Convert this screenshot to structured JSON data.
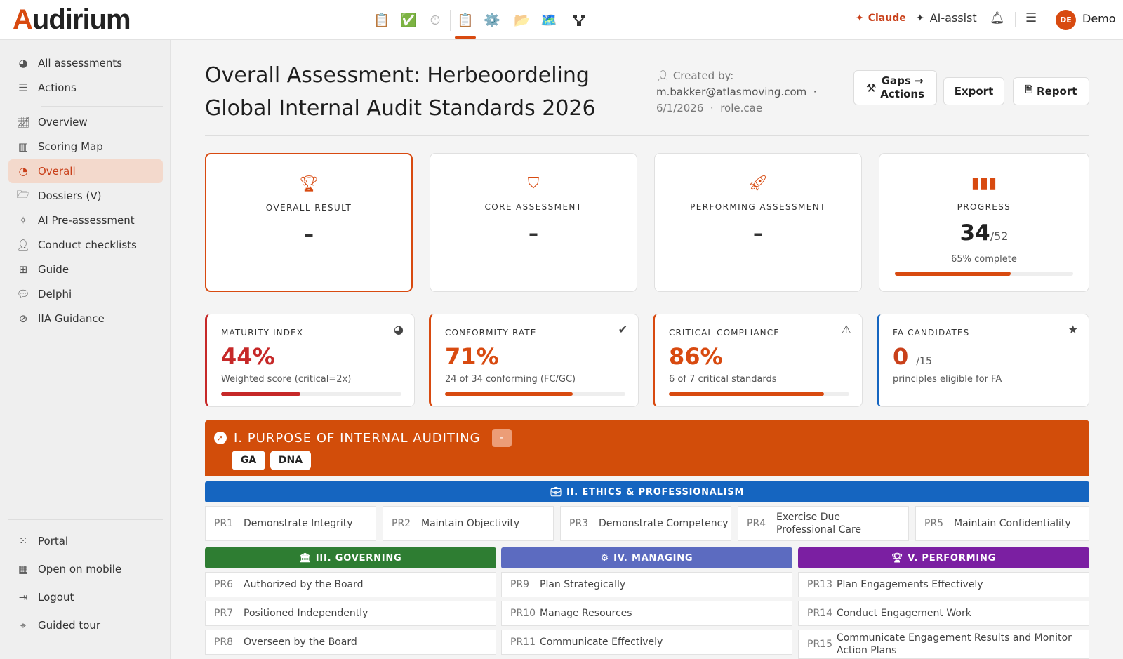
{
  "app": {
    "logo": "Audirium",
    "claude": "Claude",
    "ai_assist": "AI-assist",
    "user_initials": "DE",
    "user_name": "Demo"
  },
  "toolbar_icons": [
    "clipboard-icon",
    "check-icon",
    "timer-icon",
    "clipboard-icon",
    "gear-icon",
    "folder-icon",
    "map-icon",
    "network-icon"
  ],
  "sidebar": {
    "top_items": [
      {
        "label": "All assessments",
        "icon": "gauge-icon"
      },
      {
        "label": "Actions",
        "icon": "list-icon"
      }
    ],
    "main_items": [
      {
        "label": "Overview",
        "icon": "chart-line-icon"
      },
      {
        "label": "Scoring Map",
        "icon": "map-icon"
      },
      {
        "label": "Overall",
        "icon": "pie-chart-icon"
      },
      {
        "label": "Dossiers (V)",
        "icon": "folder-open-icon"
      },
      {
        "label": "AI Pre-assessment",
        "icon": "magic-wand-icon"
      },
      {
        "label": "Conduct checklists",
        "icon": "user-check-icon"
      },
      {
        "label": "Guide",
        "icon": "sitemap-icon"
      },
      {
        "label": "Delphi",
        "icon": "comments-icon"
      },
      {
        "label": "IIA Guidance",
        "icon": "compass-icon"
      }
    ],
    "bottom_items": [
      {
        "label": "Portal",
        "icon": "grid-icon"
      },
      {
        "label": "Open on mobile",
        "icon": "qr-icon"
      },
      {
        "label": "Logout",
        "icon": "logout-icon"
      },
      {
        "label": "Guided tour",
        "icon": "map-marker-icon"
      }
    ]
  },
  "header": {
    "title": "Overall Assessment: Herbeoordeling Global Internal Audit Standards 2026",
    "created_label": "Created by:",
    "created_by": "m.bakker@atlasmoving.com",
    "created_date": "6/1/2026",
    "created_role": "role.cae",
    "gaps_line1": "Gaps →",
    "gaps_line2": "Actions",
    "export": "Export",
    "report": "Report"
  },
  "cards": {
    "overall": {
      "label": "OVERALL RESULT",
      "value": "–"
    },
    "core": {
      "label": "CORE ASSESSMENT",
      "value": "–"
    },
    "performing": {
      "label": "PERFORMING ASSESSMENT",
      "value": "–"
    },
    "progress": {
      "label": "PROGRESS",
      "value": "34",
      "total": "/52",
      "sub": "65% complete",
      "fraction": 0.65
    }
  },
  "kpis": {
    "maturity": {
      "label": "MATURITY INDEX",
      "value": "44%",
      "sub": "Weighted score (critical=2x)",
      "fraction": 0.44,
      "color": "#c62828"
    },
    "conformity": {
      "label": "CONFORMITY RATE",
      "value": "71%",
      "sub": "24 of 34 conforming (FC/GC)",
      "fraction": 0.71,
      "color": "#d84a10"
    },
    "critical": {
      "label": "CRITICAL COMPLIANCE",
      "value": "86%",
      "sub": "6 of 7 critical standards",
      "fraction": 0.86,
      "color": "#d84a10"
    },
    "fa": {
      "label": "FA CANDIDATES",
      "value": "0",
      "total": "/15",
      "sub": "principles eligible for FA",
      "color": "#1565c0"
    }
  },
  "purpose": {
    "title": "I. PURPOSE OF INTERNAL AUDITING",
    "dash": "-",
    "chips": [
      "GA",
      "DNA"
    ]
  },
  "ethics": {
    "title": "II. ETHICS & PROFESSIONALISM",
    "color": "#1565c0",
    "principles": [
      {
        "code": "PR1",
        "name": "Demonstrate Integrity"
      },
      {
        "code": "PR2",
        "name": "Maintain Objectivity"
      },
      {
        "code": "PR3",
        "name": "Demonstrate Competency"
      },
      {
        "code": "PR4",
        "name": "Exercise Due Professional Care"
      },
      {
        "code": "PR5",
        "name": "Maintain Confidentiality"
      }
    ]
  },
  "governing": {
    "title": "III. GOVERNING",
    "color": "#2e7d32",
    "principles": [
      {
        "code": "PR6",
        "name": "Authorized by the Board"
      },
      {
        "code": "PR7",
        "name": "Positioned Independently"
      },
      {
        "code": "PR8",
        "name": "Overseen by the Board"
      }
    ]
  },
  "managing": {
    "title": "IV. MANAGING",
    "color": "#5c6bc0",
    "principles": [
      {
        "code": "PR9",
        "name": "Plan Strategically"
      },
      {
        "code": "PR10",
        "name": "Manage Resources"
      },
      {
        "code": "PR11",
        "name": "Communicate Effectively"
      }
    ]
  },
  "performing": {
    "title": "V. PERFORMING",
    "color": "#7b1fa2",
    "principles": [
      {
        "code": "PR13",
        "name": "Plan Engagements Effectively"
      },
      {
        "code": "PR14",
        "name": "Conduct Engagement Work"
      },
      {
        "code": "PR15",
        "name": "Communicate Engagement Results and Monitor Action Plans"
      }
    ]
  }
}
